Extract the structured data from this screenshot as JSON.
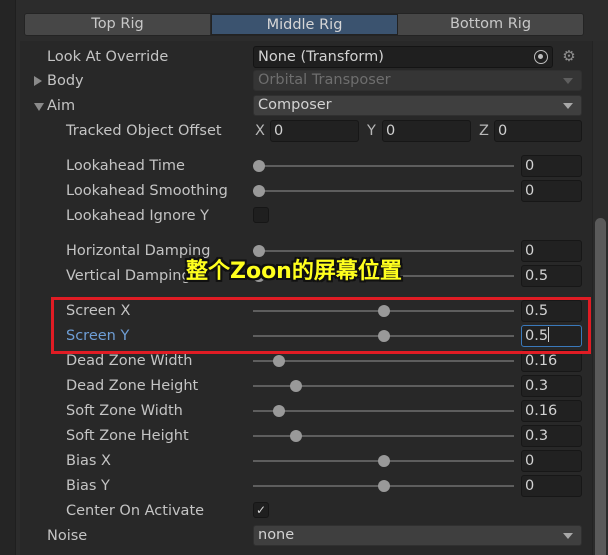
{
  "tabs": [
    {
      "label": "Top Rig",
      "active": false
    },
    {
      "label": "Middle Rig",
      "active": true
    },
    {
      "label": "Bottom Rig",
      "active": false
    }
  ],
  "look_at_override": {
    "label": "Look At Override",
    "value": "None (Transform)"
  },
  "body": {
    "label": "Body",
    "value": "Orbital Transposer",
    "expanded": false,
    "disabled": true
  },
  "aim": {
    "label": "Aim",
    "value": "Composer",
    "expanded": true
  },
  "tracked_object_offset": {
    "label": "Tracked Object Offset",
    "x_label": "X",
    "x": "0",
    "y_label": "Y",
    "y": "0",
    "z_label": "Z",
    "z": "0"
  },
  "sliders": [
    {
      "id": "lookahead-time",
      "label": "Lookahead Time",
      "value": "0",
      "fraction": 0.0
    },
    {
      "id": "lookahead-smoothing",
      "label": "Lookahead Smoothing",
      "value": "0",
      "fraction": 0.0
    },
    {
      "id": "horizontal-damping",
      "label": "Horizontal Damping",
      "value": "0",
      "fraction": 0.0
    },
    {
      "id": "vertical-damping",
      "label": "Vertical Damping",
      "value": "0.5",
      "fraction": 0.0
    },
    {
      "id": "screen-x",
      "label": "Screen X",
      "value": "0.5",
      "fraction": 0.5
    },
    {
      "id": "screen-y",
      "label": "Screen Y",
      "value": "0.5",
      "fraction": 0.5,
      "focused": true
    },
    {
      "id": "dead-zone-width",
      "label": "Dead Zone Width",
      "value": "0.16",
      "fraction": 0.08
    },
    {
      "id": "dead-zone-height",
      "label": "Dead Zone Height",
      "value": "0.3",
      "fraction": 0.15
    },
    {
      "id": "soft-zone-width",
      "label": "Soft Zone Width",
      "value": "0.16",
      "fraction": 0.08
    },
    {
      "id": "soft-zone-height",
      "label": "Soft Zone Height",
      "value": "0.3",
      "fraction": 0.15
    },
    {
      "id": "bias-x",
      "label": "Bias X",
      "value": "0",
      "fraction": 0.5
    },
    {
      "id": "bias-y",
      "label": "Bias Y",
      "value": "0",
      "fraction": 0.5
    }
  ],
  "lookahead_ignore_y": {
    "label": "Lookahead Ignore Y",
    "checked": false
  },
  "center_on_activate": {
    "label": "Center On Activate",
    "checked": true,
    "check_glyph": "✓"
  },
  "noise": {
    "label": "Noise",
    "value": "none"
  },
  "annotation": {
    "text": "整个Zoon的屏幕位置",
    "color": "#ffff1e",
    "box_color": "#e01c24"
  },
  "icons": {
    "gear": "⚙"
  }
}
